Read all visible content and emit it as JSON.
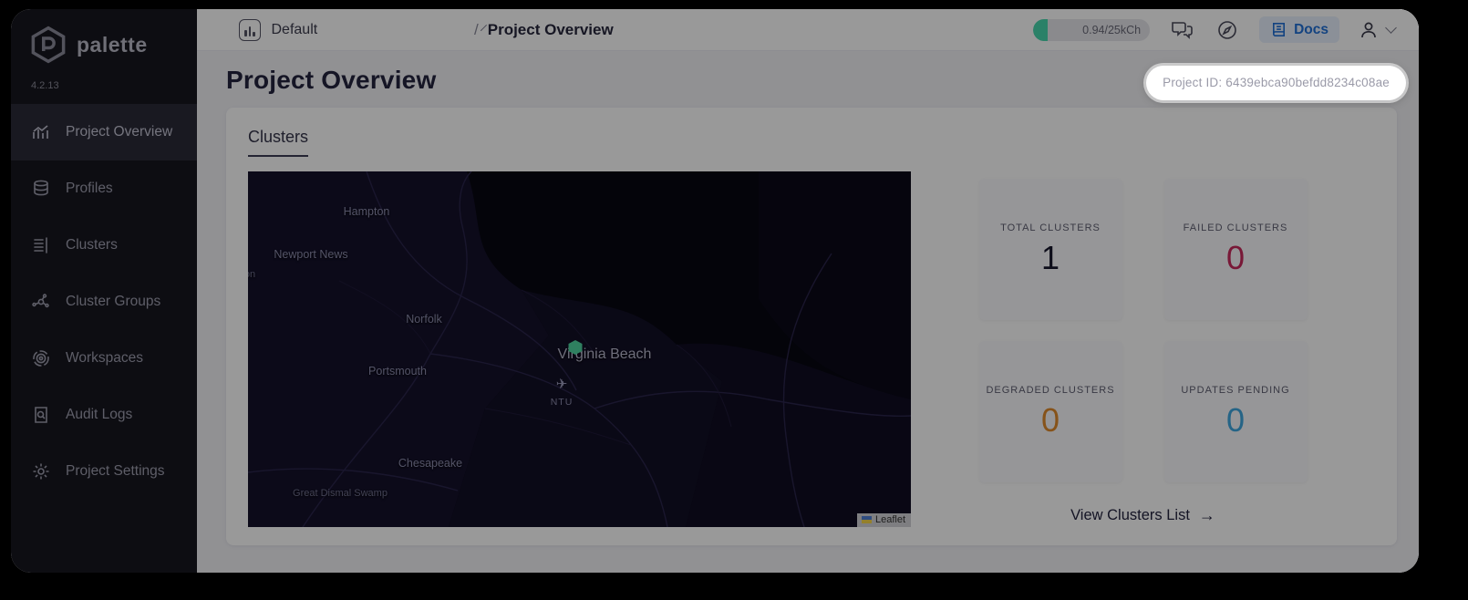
{
  "app": {
    "logo_text": "palette",
    "version": "4.2.13"
  },
  "sidebar": {
    "items": [
      {
        "label": "Project Overview",
        "icon": "bar-chart",
        "active": true
      },
      {
        "label": "Profiles",
        "icon": "database",
        "active": false
      },
      {
        "label": "Clusters",
        "icon": "server-list",
        "active": false
      },
      {
        "label": "Cluster Groups",
        "icon": "network-nodes",
        "active": false
      },
      {
        "label": "Workspaces",
        "icon": "concentric-circles",
        "active": false
      },
      {
        "label": "Audit Logs",
        "icon": "document-search",
        "active": false
      },
      {
        "label": "Project Settings",
        "icon": "gear",
        "active": false
      }
    ]
  },
  "topbar": {
    "project_selector": {
      "value": "Default"
    },
    "breadcrumb_slash": "/",
    "breadcrumb": "Project Overview",
    "usage": "0.94/25kCh",
    "docs_label": "Docs"
  },
  "page": {
    "title": "Project Overview",
    "project_id_pill": "Project ID: 6439ebca90befdd8234c08ae"
  },
  "clusters_section": {
    "tab_label": "Clusters",
    "view_list_label": "View Clusters List",
    "view_list_arrow": "→"
  },
  "stats": {
    "items": [
      {
        "label": "TOTAL CLUSTERS",
        "value": "1",
        "color": "#16162c"
      },
      {
        "label": "FAILED CLUSTERS",
        "value": "0",
        "color": "#c9295c"
      },
      {
        "label": "DEGRADED CLUSTERS",
        "value": "0",
        "color": "#e08a2c"
      },
      {
        "label": "UPDATES PENDING",
        "value": "0",
        "color": "#3fa7e0"
      }
    ]
  },
  "map": {
    "labels": [
      {
        "text": "Hampton"
      },
      {
        "text": "Newport News"
      },
      {
        "text": "llton"
      },
      {
        "text": "Norfolk"
      },
      {
        "text": "Virginia Beach"
      },
      {
        "text": "Portsmouth"
      },
      {
        "text": "Chesapeake"
      },
      {
        "text": "Great Dismal Swamp"
      }
    ],
    "airport": {
      "code": "NTU",
      "plane_glyph": "✈"
    },
    "marker": {
      "type": "healthy-cluster-hexagon",
      "color": "#4fd6a0"
    },
    "attribution": "Leaflet"
  },
  "colors": {
    "sidebar_bg": "#17171f",
    "accent_green": "#49d8ae",
    "docs_blue": "#2070d8",
    "overlay": "rgba(0,0,0,0.40)"
  }
}
